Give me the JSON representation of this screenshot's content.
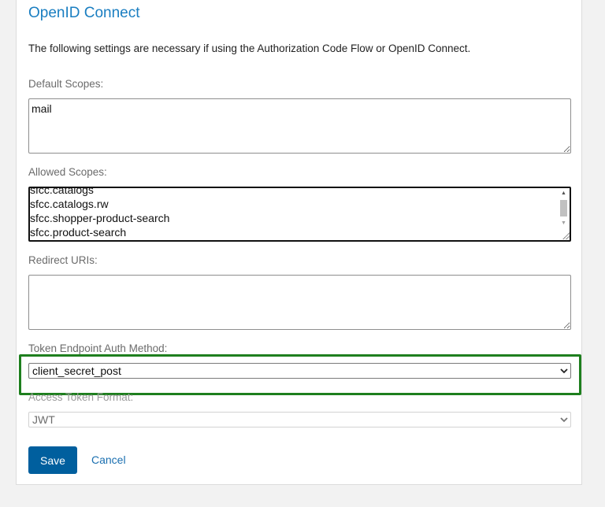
{
  "section": {
    "title": "OpenID Connect",
    "intro": "The following settings are necessary if using the Authorization Code Flow or OpenID Connect."
  },
  "default_scopes": {
    "label": "Default Scopes:",
    "value": "mail"
  },
  "allowed_scopes": {
    "label": "Allowed Scopes:",
    "visible_lines": [
      "sfcc.catalogs",
      "sfcc.catalogs.rw",
      "sfcc.shopper-product-search",
      "sfcc.product-search"
    ]
  },
  "redirect_uris": {
    "label": "Redirect URIs:",
    "value": ""
  },
  "token_endpoint_auth_method": {
    "label": "Token Endpoint Auth Method:",
    "selected": "client_secret_post"
  },
  "access_token_format": {
    "label": "Access Token Format:",
    "selected": "JWT"
  },
  "actions": {
    "save_label": "Save",
    "cancel_label": "Cancel"
  },
  "colors": {
    "title": "#1a7ec1",
    "save_button": "#005f9e",
    "highlight": "#1e7f1e"
  }
}
